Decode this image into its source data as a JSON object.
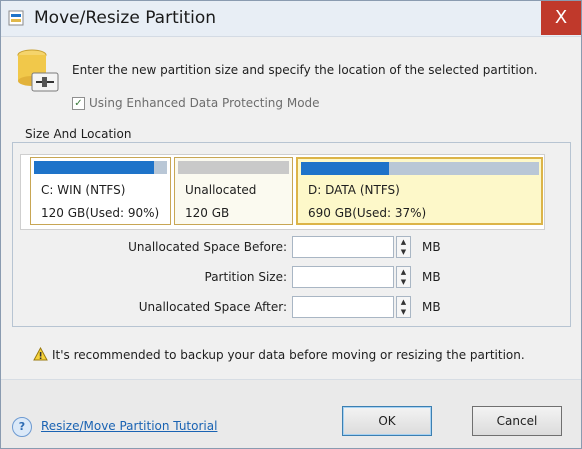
{
  "window": {
    "title": "Move/Resize Partition",
    "close_glyph": "X"
  },
  "header": {
    "instruction": "Enter the new partition size and specify the location of the selected partition.",
    "checkbox_label": "Using Enhanced Data Protecting Mode",
    "checkbox_checked": true
  },
  "group": {
    "label": "Size And Location"
  },
  "partitions": [
    {
      "name": "C: WIN (NTFS)",
      "detail": "120 GB(Used: 90%)",
      "used_fraction": 0.9
    },
    {
      "name": "Unallocated",
      "detail": "120 GB",
      "used_fraction": 0
    },
    {
      "name": "D: DATA (NTFS)",
      "detail": "690 GB(Used: 37%)",
      "used_fraction": 0.37
    }
  ],
  "fields": [
    {
      "label": "Unallocated Space Before:",
      "value": "",
      "unit": "MB"
    },
    {
      "label": "Partition Size:",
      "value": "",
      "unit": "MB"
    },
    {
      "label": "Unallocated Space After:",
      "value": "",
      "unit": "MB"
    }
  ],
  "warning": {
    "text": "It's recommended to backup your data before moving or resizing the partition."
  },
  "footer": {
    "help_link": "Resize/Move Partition Tutorial",
    "ok_label": "OK",
    "cancel_label": "Cancel"
  },
  "colors": {
    "used_bar": "#1e73c9",
    "partition_border": "#c8a654",
    "close_button": "#c0392b"
  }
}
